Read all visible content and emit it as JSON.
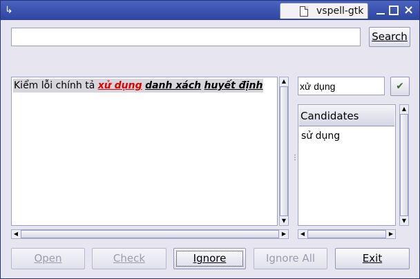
{
  "window": {
    "title": "vspell-gtk"
  },
  "search": {
    "value": "",
    "button_label": "Search"
  },
  "text": {
    "plain": "Kiểm lỗi chính tả ",
    "errors": [
      "xử dụng",
      "danh xách",
      "huyết định"
    ]
  },
  "suggestion": {
    "value": "xử dụng"
  },
  "candidates": {
    "header": "Candidates",
    "items": [
      "sử dụng"
    ]
  },
  "buttons": {
    "open": "Open",
    "check": "Check",
    "ignore": "Ignore",
    "ignore_all": "Ignore All",
    "exit": "Exit"
  },
  "colors": {
    "titlebar": "#3a52b0",
    "error_current": "#e00000",
    "background": "#e7e6f0"
  }
}
